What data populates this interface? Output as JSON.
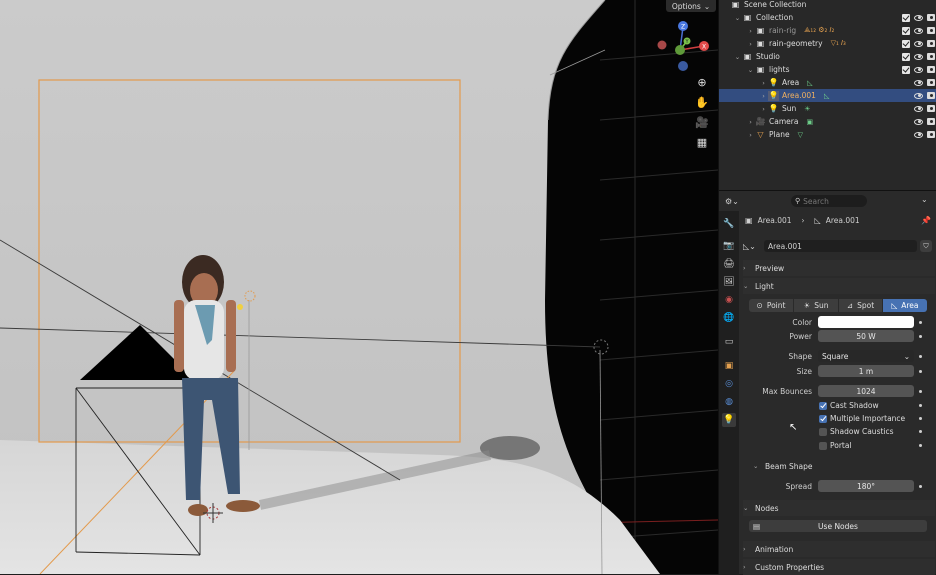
{
  "viewport": {
    "options_label": "Options",
    "gizmo_axes": {
      "z": "Z",
      "y": "Y",
      "x": "X"
    }
  },
  "outliner": {
    "rows": [
      {
        "label": "Scene Collection"
      },
      {
        "label": "Collection"
      },
      {
        "label": "rain-rig",
        "extras": "⟁₁₂ ⚙₂ 𝐼₂"
      },
      {
        "label": "rain-geometry",
        "extras": "▽₁ 𝐼₃"
      },
      {
        "label": "Studio"
      },
      {
        "label": "lights"
      },
      {
        "label": "Area"
      },
      {
        "label": "Area.001"
      },
      {
        "label": "Sun"
      },
      {
        "label": "Camera"
      },
      {
        "label": "Plane"
      }
    ]
  },
  "properties": {
    "search_placeholder": "Search",
    "breadcrumb": {
      "object": "Area.001",
      "data": "Area.001"
    },
    "datablock_name": "Area.001",
    "panels": {
      "preview": "Preview",
      "light": "Light",
      "beam_shape": "Beam Shape",
      "nodes": "Nodes",
      "animation": "Animation",
      "custom_properties": "Custom Properties"
    },
    "light_types": [
      "Point",
      "Sun",
      "Spot",
      "Area"
    ],
    "active_light_type": "Area",
    "fields": {
      "color_label": "Color",
      "color_value": "#ffffff",
      "power_label": "Power",
      "power_value": "50 W",
      "shape_label": "Shape",
      "shape_value": "Square",
      "size_label": "Size",
      "size_value": "1 m",
      "max_bounces_label": "Max Bounces",
      "max_bounces_value": "1024",
      "spread_label": "Spread",
      "spread_value": "180°"
    },
    "checkboxes": [
      {
        "label": "Cast Shadow",
        "checked": true
      },
      {
        "label": "Multiple Importance",
        "checked": true
      },
      {
        "label": "Shadow Caustics",
        "checked": false
      },
      {
        "label": "Portal",
        "checked": false
      }
    ],
    "use_nodes_label": "Use Nodes"
  },
  "colors": {
    "accent": "#4772b3",
    "selected_row": "#334d80",
    "light_orange": "#e3a04f",
    "light_green": "#6ecf8b"
  }
}
